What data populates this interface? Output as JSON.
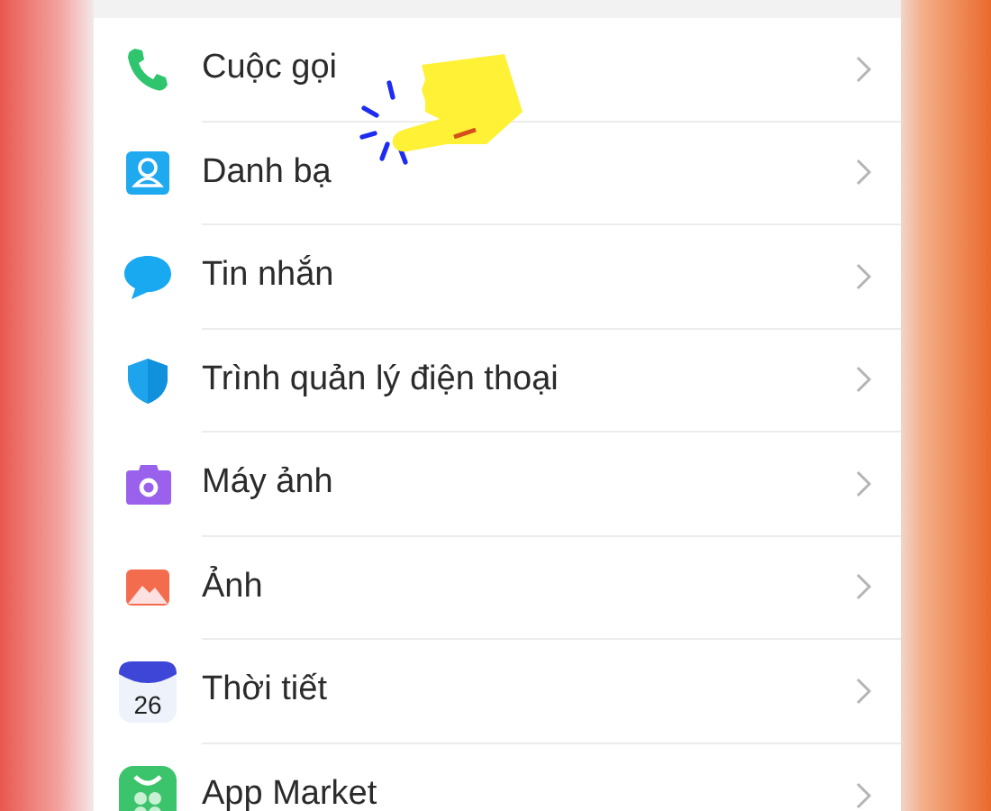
{
  "settings_list": [
    {
      "kind": "phone",
      "label": "Cuộc gọi"
    },
    {
      "kind": "contacts",
      "label": "Danh bạ"
    },
    {
      "kind": "message",
      "label": "Tin nhắn"
    },
    {
      "kind": "shield",
      "label": "Trình quản lý điện thoại"
    },
    {
      "kind": "camera",
      "label": "Máy ảnh"
    },
    {
      "kind": "gallery",
      "label": "Ảnh"
    },
    {
      "kind": "weather",
      "label": "Thời tiết",
      "icon_text": "26"
    },
    {
      "kind": "market",
      "label": "App Market"
    }
  ]
}
